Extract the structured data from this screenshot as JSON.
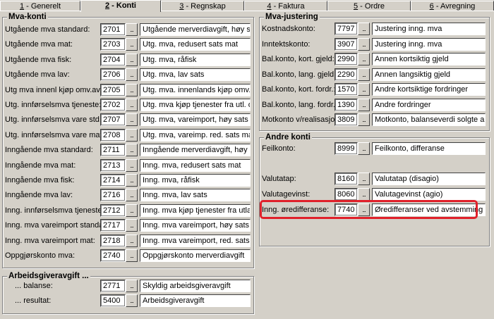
{
  "tabs": [
    {
      "num": "1",
      "label": " - Generelt"
    },
    {
      "num": "2",
      "label": " - Konti"
    },
    {
      "num": "3",
      "label": " - Regnskap"
    },
    {
      "num": "4",
      "label": " - Faktura"
    },
    {
      "num": "5",
      "label": " - Ordre"
    },
    {
      "num": "6",
      "label": " - Avregning"
    }
  ],
  "browse_label": "...",
  "mva_konti": {
    "title": "Mva-konti",
    "rows": [
      {
        "label": "Utgående mva standard:",
        "code": "2701",
        "desc": "Utgående merverdiavgift, høy sats"
      },
      {
        "label": "Utgående mva mat:",
        "code": "2703",
        "desc": "Utg. mva, redusert sats mat"
      },
      {
        "label": "Utgående mva fisk:",
        "code": "2704",
        "desc": "Utg. mva, råfisk"
      },
      {
        "label": "Utgående mva lav:",
        "code": "2706",
        "desc": "Utg. mva, lav sats"
      },
      {
        "label": "Utg mva innenl kjøp omv.av.pl.:",
        "code": "2705",
        "desc": "Utg. mva. innenlands kjøp omv. avg"
      },
      {
        "label": "Utg. innførselsmva tjeneste:",
        "code": "2702",
        "desc": "Utg. mva kjøp tjenester fra utl. omv.a"
      },
      {
        "label": "Utg. innførselsmva vare std.:",
        "code": "2707",
        "desc": "Utg. mva, vareimport, høy sats omv"
      },
      {
        "label": "Utg. innførselsmva vare mat:",
        "code": "2708",
        "desc": "Utg. mva, vareimp. red. sats mat omv"
      },
      {
        "label": "Inngående mva standard:",
        "code": "2711",
        "desc": "Inngående merverdiavgift, høy sats"
      },
      {
        "label": "Inngående mva mat:",
        "code": "2713",
        "desc": "Inng. mva, redusert sats mat"
      },
      {
        "label": "Inngående mva fisk:",
        "code": "2714",
        "desc": "Inng. mva, råfisk"
      },
      {
        "label": "Inngående mva lav:",
        "code": "2716",
        "desc": "Inng. mva, lav sats"
      },
      {
        "label": "Inng. innførselsmva tjeneste:",
        "code": "2712",
        "desc": "Inng. mva kjøp tjenester fra utlandet"
      },
      {
        "label": "Inng. mva vareimport standard:",
        "code": "2717",
        "desc": "Inng. mva vareimport, høy sats"
      },
      {
        "label": "Inng. mva vareimport mat:",
        "code": "2718",
        "desc": "Inng. mva vareimport, red. sats mat"
      },
      {
        "label": "Oppgjørskonto mva:",
        "code": "2740",
        "desc": "Oppgjørskonto merverdiavgift"
      }
    ]
  },
  "arbeidsgiveravgift": {
    "title": "Arbeidsgiveravgift ...",
    "rows": [
      {
        "label": "... balanse:",
        "code": "2771",
        "desc": "Skyldig arbeidsgiveravgift"
      },
      {
        "label": "... resultat:",
        "code": "5400",
        "desc": "Arbeidsgiveravgift"
      }
    ]
  },
  "mva_justering": {
    "title": "Mva-justering",
    "rows": [
      {
        "label": "Kostnadskonto:",
        "code": "7797",
        "desc": "Justering inng. mva"
      },
      {
        "label": "Inntektskonto:",
        "code": "3907",
        "desc": "Justering inng. mva"
      },
      {
        "label": "Bal.konto, kort. gjeld:",
        "code": "2990",
        "desc": "Annen kortsiktig gjeld"
      },
      {
        "label": "Bal.konto, lang. gjeld:",
        "code": "2290",
        "desc": "Annen langsiktig gjeld"
      },
      {
        "label": "Bal.konto, kort. fordr.:",
        "code": "1570",
        "desc": "Andre kortsiktige fordringer"
      },
      {
        "label": "Bal.konto, lang. fordr.:",
        "code": "1390",
        "desc": "Andre fordringer"
      },
      {
        "label": "Motkonto v/realisasjon:",
        "code": "3809",
        "desc": "Motkonto, balanseverdi solgte anl.m"
      }
    ]
  },
  "andre_konti": {
    "title": "Andre konti",
    "feilkonto": {
      "label": "Feilkonto:",
      "code": "8999",
      "desc": "Feilkonto, differanse"
    },
    "valutatap": {
      "label": "Valutatap:",
      "code": "8160",
      "desc": "Valutatap (disagio)"
    },
    "valutagevinst": {
      "label": "Valutagevinst:",
      "code": "8060",
      "desc": "Valutagevinst (agio)"
    },
    "oredifferanse": {
      "label": "Inng. øredifferanse:",
      "code": "7740",
      "desc": "Øredifferanser ved avstemming"
    }
  },
  "colors": {
    "highlight": "#e0202a",
    "window": "#d4d0c8"
  }
}
